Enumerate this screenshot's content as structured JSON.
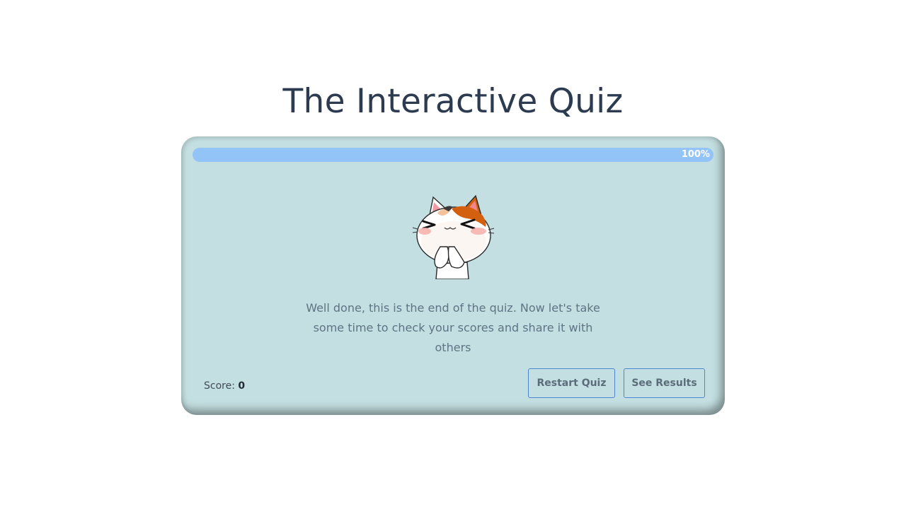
{
  "header": {
    "title": "The Interactive Quiz"
  },
  "progress": {
    "percent": 100,
    "label": "100%"
  },
  "mascot": {
    "icon": "celebrating-cat-icon"
  },
  "result": {
    "message": "Well done, this is the end of the quiz. Now let's take some time to check your scores and share it with others"
  },
  "score": {
    "label": "Score:",
    "value": "0"
  },
  "actions": {
    "restart_label": "Restart Quiz",
    "results_label": "See Results"
  },
  "colors": {
    "card_background": "#c4dfe1",
    "progress_fill": "#93c4f8",
    "button_border": "#4b86d6",
    "title_text": "#2d3b50"
  }
}
